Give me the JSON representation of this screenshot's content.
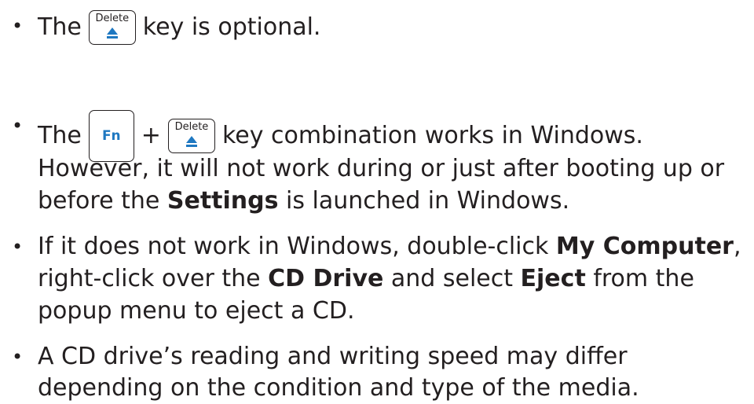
{
  "bullet_char": "•",
  "item1": {
    "prefix": "The",
    "key_delete": "Delete",
    "suffix": "key is optional."
  },
  "item2": {
    "prefix": "The",
    "key_fn": "Fn",
    "plus": "+",
    "key_delete": "Delete",
    "suffix": "key combination works in Windows.",
    "line2": "However, it will not work during or just after booting up or",
    "line3_a": "before the ",
    "line3_bold": "Settings",
    "line3_b": " is launched in Windows."
  },
  "item3": {
    "l1_a": "If it does not work in Windows, double-click ",
    "l1_bold": "My Computer",
    "l1_b": ",",
    "l2_a": "right-click over the ",
    "l2_bold1": "CD Drive",
    "l2_b": " and select ",
    "l2_bold2": "Eject",
    "l2_c": " from the",
    "l3": "popup menu to eject a CD."
  },
  "item4": {
    "l1": "A CD drive’s reading and writing speed may differ",
    "l2": "depending on the condition and type of the media."
  },
  "colors": {
    "text": "#231f20",
    "accent": "#1f78c1"
  },
  "icons": {
    "eject": "eject-icon"
  }
}
